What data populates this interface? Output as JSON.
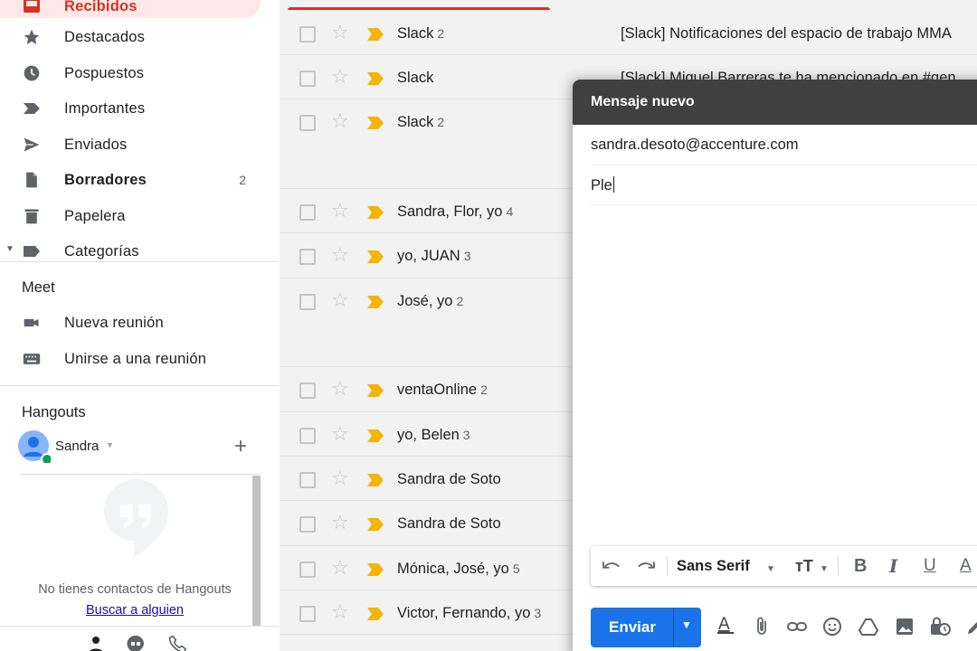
{
  "sidebar": {
    "items": [
      {
        "label": "Recibidos",
        "icon": "inbox-icon",
        "count": ""
      },
      {
        "label": "Destacados",
        "icon": "star-icon",
        "count": ""
      },
      {
        "label": "Pospuestos",
        "icon": "clock-icon",
        "count": ""
      },
      {
        "label": "Importantes",
        "icon": "important-icon",
        "count": ""
      },
      {
        "label": "Enviados",
        "icon": "send-icon",
        "count": ""
      },
      {
        "label": "Borradores",
        "icon": "draft-icon",
        "count": "2"
      },
      {
        "label": "Papelera",
        "icon": "trash-icon",
        "count": ""
      },
      {
        "label": "Categorías",
        "icon": "label-icon",
        "count": ""
      }
    ],
    "meet": {
      "title": "Meet",
      "new_meeting": "Nueva reunión",
      "join_meeting": "Unirse a una reunión"
    },
    "hangouts": {
      "title": "Hangouts",
      "user": "Sandra",
      "empty_text": "No tienes contactos de Hangouts",
      "search_link": "Buscar a alguien"
    }
  },
  "emails": [
    {
      "sender": "Slack",
      "count": "2",
      "subject": "[Slack] Notificaciones del espacio de trabajo MMA"
    },
    {
      "sender": "Slack",
      "count": "",
      "subject": "[Slack] Miguel Barreras te ha mencionado en #gen"
    },
    {
      "sender": "Slack",
      "count": "2",
      "subject": ""
    },
    {
      "sender": "Sandra, Flor, yo",
      "count": "4",
      "subject": ""
    },
    {
      "sender": "yo, JUAN",
      "count": "3",
      "subject": ""
    },
    {
      "sender": "José, yo",
      "count": "2",
      "subject": ""
    },
    {
      "sender": "ventaOnline",
      "count": "2",
      "subject": ""
    },
    {
      "sender": "yo, Belen",
      "count": "3",
      "subject": ""
    },
    {
      "sender": "Sandra de Soto",
      "count": "",
      "subject": ""
    },
    {
      "sender": "Sandra de Soto",
      "count": "",
      "subject": ""
    },
    {
      "sender": "Mónica, José, yo",
      "count": "5",
      "subject": ""
    },
    {
      "sender": "Victor, Fernando, yo",
      "count": "3",
      "subject": ""
    }
  ],
  "compose": {
    "title": "Mensaje nuevo",
    "to": "sandra.desoto@accenture.com",
    "subject": "Ple",
    "font": "Sans Serif",
    "send_label": "Enviar"
  },
  "colors": {
    "accent": "#1a73e8",
    "active_nav": "#fce8e6",
    "important_marker": "#f4b400",
    "compose_header": "#404040"
  }
}
